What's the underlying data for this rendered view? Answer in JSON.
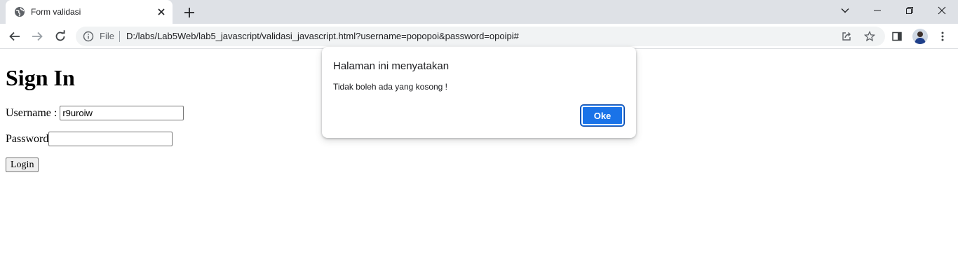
{
  "browser": {
    "tab": {
      "title": "Form validasi",
      "favicon": "globe-icon",
      "close_icon": "close-icon"
    },
    "new_tab_icon": "plus-icon",
    "window_controls": [
      "chevron-down-icon",
      "minimize-icon",
      "restore-icon",
      "close-icon"
    ],
    "nav": [
      "back-arrow-icon",
      "forward-arrow-icon",
      "reload-icon"
    ],
    "omnibox": {
      "scheme_label": "File",
      "url": "D:/labs/Lab5Web/lab5_javascript/validasi_javascript.html?username=popopoi&password=opoipi#",
      "icons": [
        "info-icon",
        "share-icon",
        "star-icon"
      ]
    },
    "toolbar_icons": [
      "side-panel-icon",
      "avatar",
      "more-vert-icon"
    ]
  },
  "page": {
    "heading": "Sign In",
    "username_label": "Username :",
    "username_value": "r9uroiw",
    "password_label": "Password",
    "password_value": "",
    "login_label": "Login"
  },
  "dialog": {
    "title": "Halaman ini menyatakan",
    "message": "Tidak boleh ada yang kosong !",
    "ok_label": "Oke"
  },
  "colors": {
    "tabstrip_bg": "#dee1e6",
    "omnibox_bg": "#f1f3f4",
    "accent": "#1a73e8"
  }
}
